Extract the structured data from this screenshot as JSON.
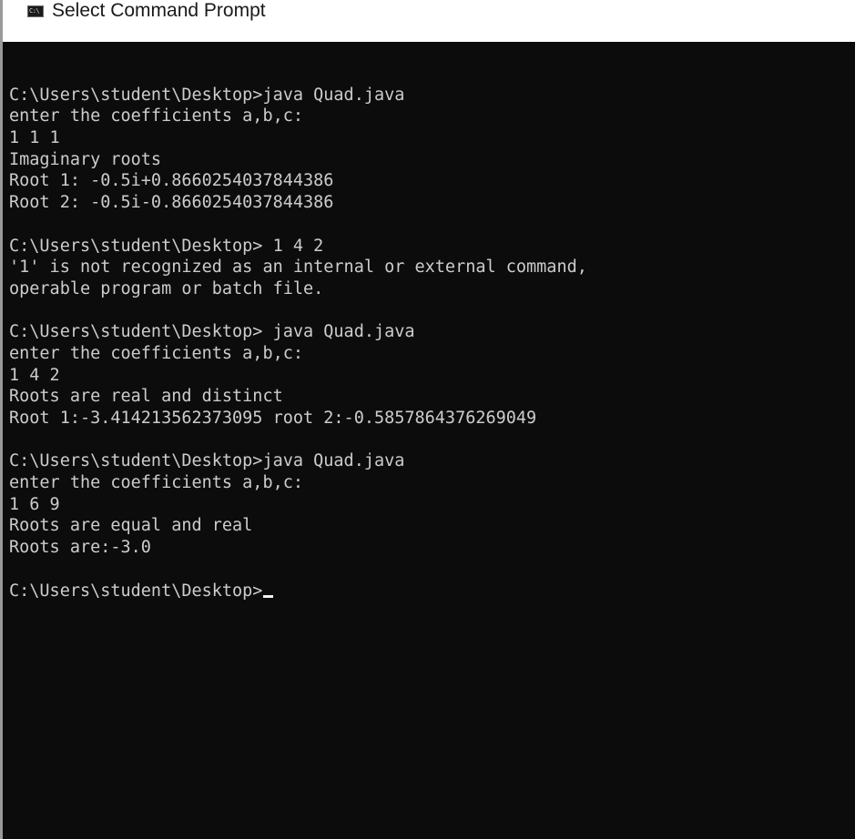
{
  "window": {
    "title": "Select Command Prompt",
    "icon": "cmd-icon",
    "icon_glyph": "C:\\"
  },
  "console": {
    "background": "#0c0c0c",
    "foreground": "#cccccc",
    "lines": [
      "",
      "C:\\Users\\student\\Desktop>java Quad.java",
      "enter the coefficients a,b,c:",
      "1 1 1",
      "Imaginary roots",
      "Root 1: -0.5i+0.8660254037844386",
      "Root 2: -0.5i-0.8660254037844386",
      "",
      "C:\\Users\\student\\Desktop> 1 4 2",
      "'1' is not recognized as an internal or external command,",
      "operable program or batch file.",
      "",
      "C:\\Users\\student\\Desktop> java Quad.java",
      "enter the coefficients a,b,c:",
      "1 4 2",
      "Roots are real and distinct",
      "Root 1:-3.414213562373095 root 2:-0.5857864376269049",
      "",
      "C:\\Users\\student\\Desktop>java Quad.java",
      "enter the coefficients a,b,c:",
      "1 6 9",
      "Roots are equal and real",
      "Roots are:-3.0",
      "",
      "C:\\Users\\student\\Desktop>"
    ]
  }
}
